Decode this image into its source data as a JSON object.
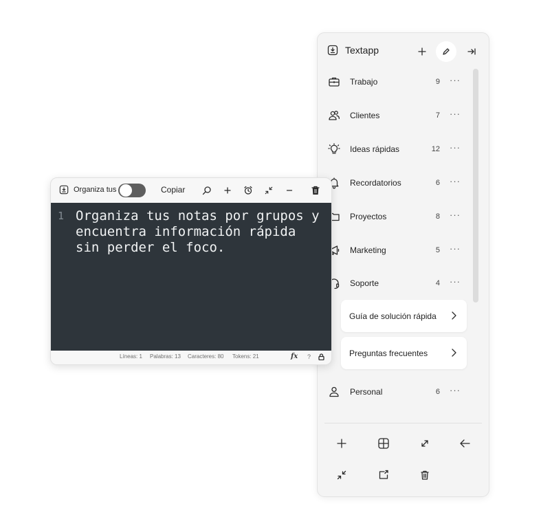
{
  "sidebar": {
    "title": "Textapp",
    "items": [
      {
        "label": "Trabajo",
        "count": "9",
        "icon": "briefcase-icon"
      },
      {
        "label": "Clientes",
        "count": "7",
        "icon": "users-icon"
      },
      {
        "label": "Ideas rápidas",
        "count": "12",
        "icon": "lightbulb-icon"
      },
      {
        "label": "Recordatorios",
        "count": "6",
        "icon": "bell-icon"
      },
      {
        "label": "Proyectos",
        "count": "8",
        "icon": "folder-icon"
      },
      {
        "label": "Marketing",
        "count": "5",
        "icon": "megaphone-icon"
      },
      {
        "label": "Soporte",
        "count": "4",
        "icon": "headset-icon"
      },
      {
        "label": "Personal",
        "count": "6",
        "icon": "person-icon"
      }
    ],
    "more_label": "···",
    "subitems": [
      {
        "label": "Guía de solución rápida"
      },
      {
        "label": "Preguntas frecuentes"
      }
    ]
  },
  "editor": {
    "title": "Organiza tus n",
    "copy_label": "Copiar",
    "line_number": "1",
    "content": "Organiza tus notas por grupos y encuentra información rápida sin perder el foco.",
    "status": {
      "lines": "Líneas: 1",
      "words": "Palabras: 13",
      "chars": "Caracteres: 80",
      "tokens": "Tokens: 21",
      "fx": "fx",
      "help": "?"
    }
  },
  "colors": {
    "editor_bg": "#2e353b",
    "editor_text": "#f1f3f4",
    "sidebar_bg": "#f4f4f4",
    "toggle_off": "#5e5e5e"
  }
}
